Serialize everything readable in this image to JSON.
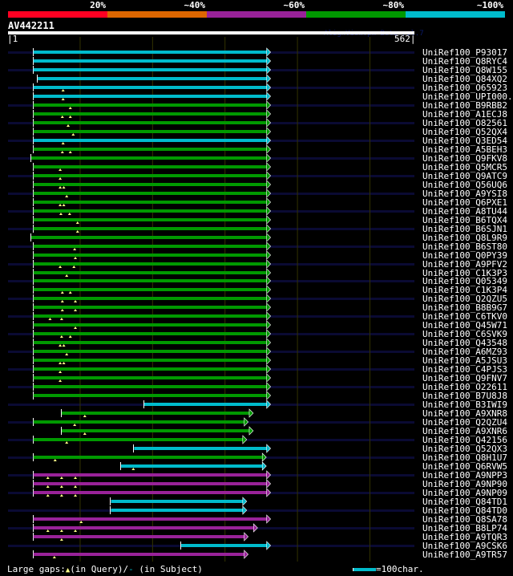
{
  "identity_legend": [
    {
      "label": "20%",
      "color": "#ff0022"
    },
    {
      "label": "~40%",
      "color": "#dd6600"
    },
    {
      "label": "~60%",
      "color": "#992299"
    },
    {
      "label": "~80%",
      "color": "#009900"
    },
    {
      "label": "~100%",
      "color": "#00bbcc"
    }
  ],
  "query": {
    "name": "AV442211",
    "start_label": "|1",
    "end_label": "562|",
    "length": 562
  },
  "watermark": "AlignView.pm Beta rel.7",
  "colors": {
    "cyan": "#00bbcc",
    "green": "#009900",
    "magenta": "#992299",
    "track": "#0a0a33",
    "grid": "#333300",
    "gap": "#ffff88"
  },
  "grid_step": 100,
  "hits": [
    {
      "name": "UniRef100_P93017",
      "color": "cyan",
      "start": 35,
      "end": 358,
      "gaps": []
    },
    {
      "name": "UniRef100_Q8RYC4",
      "color": "cyan",
      "start": 35,
      "end": 358,
      "gaps": []
    },
    {
      "name": "UniRef100_Q8W155",
      "color": "cyan",
      "start": 35,
      "end": 358,
      "gaps": []
    },
    {
      "name": "UniRef100_Q84XQ2",
      "color": "cyan",
      "start": 41,
      "end": 358,
      "gaps": []
    },
    {
      "name": "UniRef100_O65923",
      "color": "cyan",
      "start": 35,
      "end": 358,
      "gaps": [
        77
      ]
    },
    {
      "name": "UniRef100_UPI000..",
      "color": "cyan",
      "start": 35,
      "end": 358,
      "gaps": [
        77
      ]
    },
    {
      "name": "UniRef100_B9RBB2",
      "color": "green",
      "start": 35,
      "end": 358,
      "gaps": [
        87
      ]
    },
    {
      "name": "UniRef100_A1ECJ8",
      "color": "green",
      "start": 35,
      "end": 358,
      "gaps": [
        76,
        87
      ]
    },
    {
      "name": "UniRef100_O82561",
      "color": "green",
      "start": 35,
      "end": 358,
      "gaps": [
        84
      ]
    },
    {
      "name": "UniRef100_Q52QX4",
      "color": "green",
      "start": 35,
      "end": 358,
      "gaps": [
        91
      ]
    },
    {
      "name": "UniRef100_Q3ED54",
      "color": "cyan",
      "start": 35,
      "end": 358,
      "gaps": [
        77
      ]
    },
    {
      "name": "UniRef100_A5BEH3",
      "color": "green",
      "start": 35,
      "end": 358,
      "gaps": [
        76,
        87
      ]
    },
    {
      "name": "UniRef100_Q9FKV8",
      "color": "green",
      "start": 32,
      "end": 358,
      "gaps": []
    },
    {
      "name": "UniRef100_Q5MCR5",
      "color": "green",
      "start": 35,
      "end": 358,
      "gaps": [
        73
      ]
    },
    {
      "name": "UniRef100_Q9ATC9",
      "color": "green",
      "start": 35,
      "end": 358,
      "gaps": [
        73
      ]
    },
    {
      "name": "UniRef100_Q56UQ6",
      "color": "green",
      "start": 35,
      "end": 358,
      "gaps": [
        73,
        78
      ]
    },
    {
      "name": "UniRef100_A9YSI8",
      "color": "green",
      "start": 35,
      "end": 358,
      "gaps": [
        82
      ]
    },
    {
      "name": "UniRef100_Q6PXE1",
      "color": "green",
      "start": 35,
      "end": 358,
      "gaps": [
        73,
        78
      ]
    },
    {
      "name": "UniRef100_A8TU44",
      "color": "green",
      "start": 35,
      "end": 358,
      "gaps": [
        74,
        86
      ]
    },
    {
      "name": "UniRef100_B6TQX4",
      "color": "green",
      "start": 35,
      "end": 358,
      "gaps": [
        97
      ]
    },
    {
      "name": "UniRef100_B6SJN1",
      "color": "green",
      "start": 35,
      "end": 358,
      "gaps": [
        97
      ]
    },
    {
      "name": "UniRef100_Q8L9R9",
      "color": "green",
      "start": 32,
      "end": 358,
      "gaps": []
    },
    {
      "name": "UniRef100_B6ST80",
      "color": "green",
      "start": 35,
      "end": 358,
      "gaps": [
        93
      ]
    },
    {
      "name": "UniRef100_Q0PY39",
      "color": "green",
      "start": 35,
      "end": 358,
      "gaps": [
        94
      ]
    },
    {
      "name": "UniRef100_A9PFV2",
      "color": "green",
      "start": 35,
      "end": 358,
      "gaps": [
        73,
        92
      ]
    },
    {
      "name": "UniRef100_C1K3P3",
      "color": "green",
      "start": 35,
      "end": 358,
      "gaps": [
        82
      ]
    },
    {
      "name": "UniRef100_Q05349",
      "color": "green",
      "start": 35,
      "end": 358,
      "gaps": []
    },
    {
      "name": "UniRef100_C1K3P4",
      "color": "green",
      "start": 35,
      "end": 358,
      "gaps": [
        76,
        87
      ]
    },
    {
      "name": "UniRef100_Q2QZU5",
      "color": "green",
      "start": 35,
      "end": 358,
      "gaps": [
        76,
        94
      ]
    },
    {
      "name": "UniRef100_B8B9G7",
      "color": "green",
      "start": 35,
      "end": 358,
      "gaps": [
        76,
        94
      ]
    },
    {
      "name": "UniRef100_C6TKV0",
      "color": "green",
      "start": 35,
      "end": 358,
      "gaps": [
        59,
        75
      ]
    },
    {
      "name": "UniRef100_Q45W71",
      "color": "green",
      "start": 35,
      "end": 358,
      "gaps": [
        94
      ]
    },
    {
      "name": "UniRef100_C6SVK9",
      "color": "green",
      "start": 35,
      "end": 358,
      "gaps": [
        75,
        87
      ]
    },
    {
      "name": "UniRef100_Q43548",
      "color": "green",
      "start": 35,
      "end": 358,
      "gaps": [
        73,
        78
      ]
    },
    {
      "name": "UniRef100_A6MZ93",
      "color": "green",
      "start": 35,
      "end": 358,
      "gaps": [
        82
      ]
    },
    {
      "name": "UniRef100_A5JSU3",
      "color": "green",
      "start": 35,
      "end": 358,
      "gaps": [
        73,
        78
      ]
    },
    {
      "name": "UniRef100_C4PJS3",
      "color": "green",
      "start": 35,
      "end": 358,
      "gaps": [
        73
      ]
    },
    {
      "name": "UniRef100_Q9FNV7",
      "color": "green",
      "start": 35,
      "end": 358,
      "gaps": [
        73
      ]
    },
    {
      "name": "UniRef100_O22611",
      "color": "green",
      "start": 35,
      "end": 358,
      "gaps": []
    },
    {
      "name": "UniRef100_B7U8J8",
      "color": "green",
      "start": 35,
      "end": 358,
      "gaps": []
    },
    {
      "name": "UniRef100_B3IWI9",
      "color": "cyan",
      "start": 188,
      "end": 358,
      "gaps": []
    },
    {
      "name": "UniRef100_A9XNR8",
      "color": "green",
      "start": 74,
      "end": 334,
      "gaps": [
        107
      ]
    },
    {
      "name": "UniRef100_Q2QZU4",
      "color": "green",
      "start": 35,
      "end": 327,
      "gaps": [
        93
      ]
    },
    {
      "name": "UniRef100_A9XNR6",
      "color": "green",
      "start": 74,
      "end": 334,
      "gaps": [
        107
      ]
    },
    {
      "name": "UniRef100_Q42156",
      "color": "green",
      "start": 35,
      "end": 325,
      "gaps": [
        82
      ]
    },
    {
      "name": "UniRef100_Q52QX3",
      "color": "cyan",
      "start": 174,
      "end": 358,
      "gaps": []
    },
    {
      "name": "UniRef100_Q8H1U7",
      "color": "green",
      "start": 35,
      "end": 352,
      "gaps": [
        66
      ]
    },
    {
      "name": "UniRef100_Q6RVW5",
      "color": "cyan",
      "start": 156,
      "end": 352,
      "gaps": [
        174
      ]
    },
    {
      "name": "UniRef100_A9NPP3",
      "color": "magenta",
      "start": 35,
      "end": 358,
      "gaps": [
        56,
        75,
        94
      ]
    },
    {
      "name": "UniRef100_A9NP90",
      "color": "magenta",
      "start": 35,
      "end": 358,
      "gaps": [
        56,
        75,
        94
      ]
    },
    {
      "name": "UniRef100_A9NP09",
      "color": "magenta",
      "start": 35,
      "end": 358,
      "gaps": [
        56,
        75,
        94
      ]
    },
    {
      "name": "UniRef100_Q84TD1",
      "color": "cyan",
      "start": 142,
      "end": 325,
      "gaps": []
    },
    {
      "name": "UniRef100_Q84TD0",
      "color": "cyan",
      "start": 142,
      "end": 325,
      "gaps": []
    },
    {
      "name": "UniRef100_Q8SA78",
      "color": "magenta",
      "start": 35,
      "end": 358,
      "gaps": [
        102
      ]
    },
    {
      "name": "UniRef100_B8LP74",
      "color": "magenta",
      "start": 35,
      "end": 340,
      "gaps": [
        56,
        75,
        94
      ]
    },
    {
      "name": "UniRef100_A9TQR3",
      "color": "magenta",
      "start": 35,
      "end": 327,
      "gaps": [
        75
      ]
    },
    {
      "name": "UniRef100_A9CSK6",
      "color": "cyan",
      "start": 239,
      "end": 358,
      "gaps": []
    },
    {
      "name": "UniRef100_A9TR57",
      "color": "magenta",
      "start": 35,
      "end": 327,
      "gaps": [
        65
      ]
    }
  ],
  "legend": {
    "gaps_prefix": "Large gaps:",
    "query_gap": "(in Query)/",
    "subject_gap_mark": "-",
    "subject_gap": " (in Subject)",
    "scale_label": "=100char."
  }
}
